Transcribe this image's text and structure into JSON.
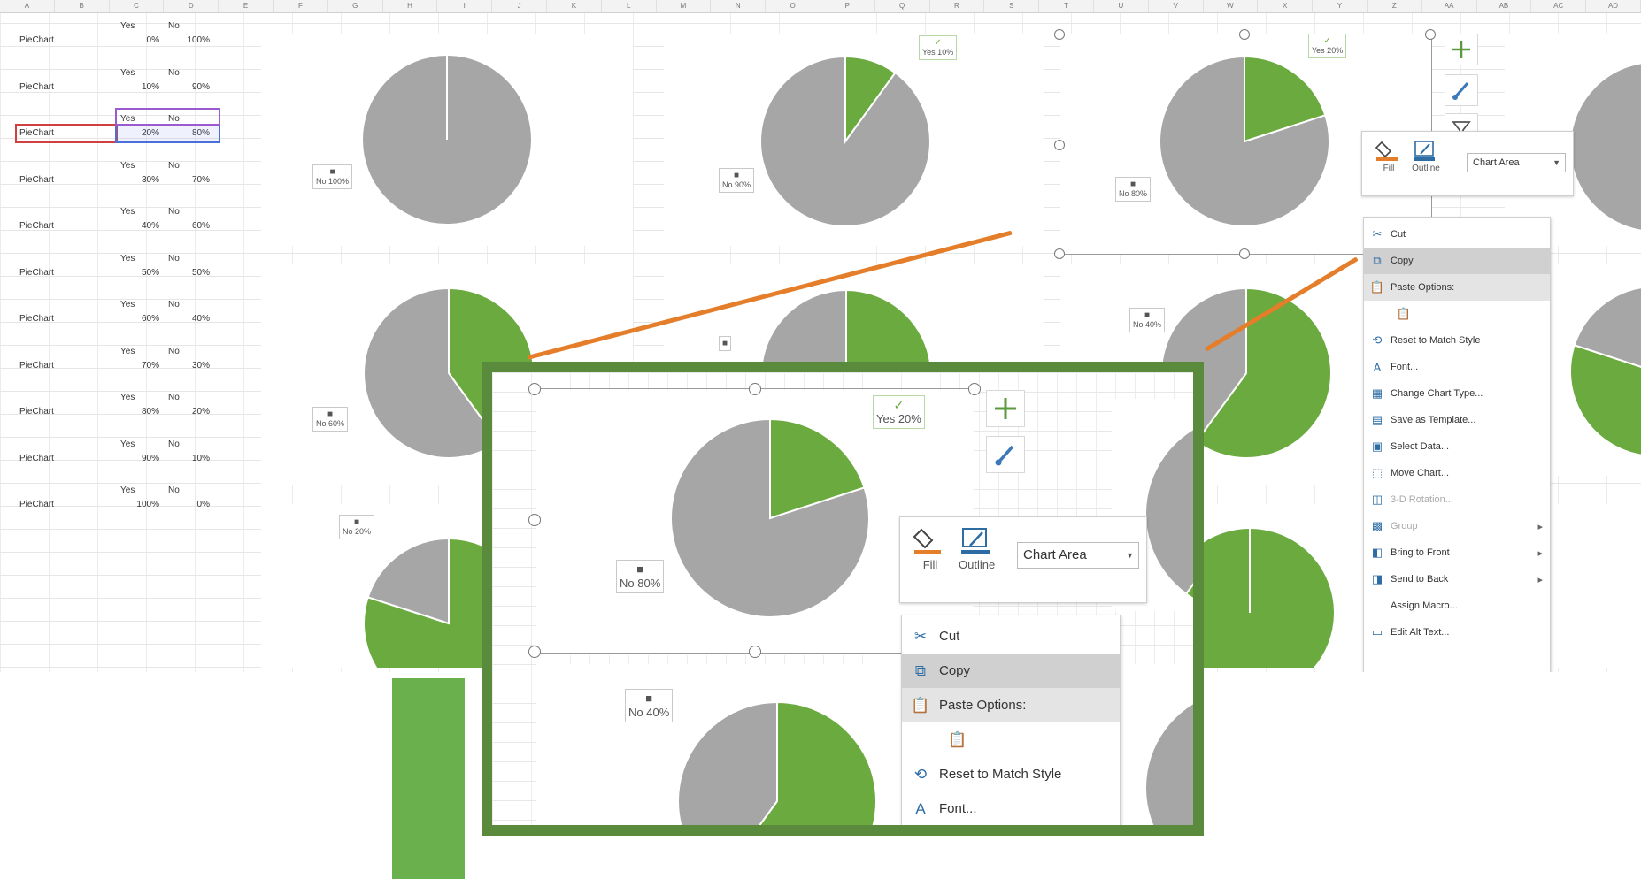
{
  "columns": [
    "A",
    "B",
    "C",
    "D",
    "E",
    "F",
    "G",
    "H",
    "I",
    "J",
    "K",
    "L",
    "M",
    "N",
    "O",
    "P",
    "Q",
    "R",
    "S",
    "T",
    "U",
    "V",
    "W",
    "X",
    "Y",
    "Z",
    "AA",
    "AB",
    "AC",
    "AD"
  ],
  "spreadsheet": {
    "header_yes": "Yes",
    "header_no": "No",
    "rows": [
      {
        "label": "PieChart",
        "yes": "0%",
        "no": "100%"
      },
      {
        "label": "PieChart",
        "yes": "10%",
        "no": "90%"
      },
      {
        "label": "PieChart",
        "yes": "20%",
        "no": "80%"
      },
      {
        "label": "PieChart",
        "yes": "30%",
        "no": "70%"
      },
      {
        "label": "PieChart",
        "yes": "40%",
        "no": "60%"
      },
      {
        "label": "PieChart",
        "yes": "50%",
        "no": "50%"
      },
      {
        "label": "PieChart",
        "yes": "60%",
        "no": "40%"
      },
      {
        "label": "PieChart",
        "yes": "70%",
        "no": "30%"
      },
      {
        "label": "PieChart",
        "yes": "80%",
        "no": "20%"
      },
      {
        "label": "PieChart",
        "yes": "90%",
        "no": "10%"
      },
      {
        "label": "PieChart",
        "yes": "100%",
        "no": "0%"
      }
    ]
  },
  "colors": {
    "yes": "#6aaa3f",
    "no": "#a6a6a6",
    "frame": "#5a8a3c",
    "leader": "#e57e2a"
  },
  "labels": {
    "no_100": "No 100%",
    "no_90": "No 90%",
    "yes_10": "Yes 10%",
    "no_80": "No 80%",
    "yes_20": "Yes 20%",
    "no_60": "No 60%",
    "no_40": "No 40%",
    "yes_20_mid": "No 20%"
  },
  "mini_toolbar": {
    "fill_label": "Fill",
    "outline_label": "Outline",
    "dropdown_value": "Chart Area"
  },
  "context_menu": {
    "items": [
      {
        "label": "Cut",
        "icon": "scissors-icon"
      },
      {
        "label": "Copy",
        "icon": "copy-icon"
      },
      {
        "label": "Paste Options:",
        "icon": "paste-icon"
      },
      {
        "label": "",
        "icon": "paste-option-icon"
      },
      {
        "label": "Reset to Match Style",
        "icon": "reset-style-icon"
      },
      {
        "label": "Font...",
        "icon": "font-icon"
      },
      {
        "label": "Change Chart Type...",
        "icon": "chart-type-icon"
      },
      {
        "label": "Save as Template...",
        "icon": "template-icon"
      },
      {
        "label": "Select Data...",
        "icon": "select-data-icon"
      },
      {
        "label": "Move Chart...",
        "icon": "move-chart-icon"
      },
      {
        "label": "3-D Rotation...",
        "icon": "rotation-icon"
      },
      {
        "label": "Group",
        "icon": "group-icon"
      },
      {
        "label": "Bring to Front",
        "icon": "bring-front-icon"
      },
      {
        "label": "Send to Back",
        "icon": "send-back-icon"
      },
      {
        "label": "Assign Macro...",
        "icon": ""
      },
      {
        "label": "Edit Alt Text...",
        "icon": "alt-text-icon"
      }
    ]
  },
  "chart_data": [
    {
      "type": "pie",
      "categories": [
        "Yes",
        "No"
      ],
      "values": [
        0,
        100
      ]
    },
    {
      "type": "pie",
      "categories": [
        "Yes",
        "No"
      ],
      "values": [
        10,
        90
      ]
    },
    {
      "type": "pie",
      "categories": [
        "Yes",
        "No"
      ],
      "values": [
        20,
        80
      ]
    },
    {
      "type": "pie",
      "categories": [
        "Yes",
        "No"
      ],
      "values": [
        40,
        60
      ]
    },
    {
      "type": "pie",
      "categories": [
        "Yes",
        "No"
      ],
      "values": [
        50,
        50
      ]
    },
    {
      "type": "pie",
      "categories": [
        "Yes",
        "No"
      ],
      "values": [
        60,
        40
      ]
    },
    {
      "type": "pie",
      "categories": [
        "Yes",
        "No"
      ],
      "values": [
        80,
        20
      ]
    },
    {
      "type": "pie",
      "categories": [
        "Yes",
        "No"
      ],
      "values": [
        100,
        0
      ]
    }
  ]
}
